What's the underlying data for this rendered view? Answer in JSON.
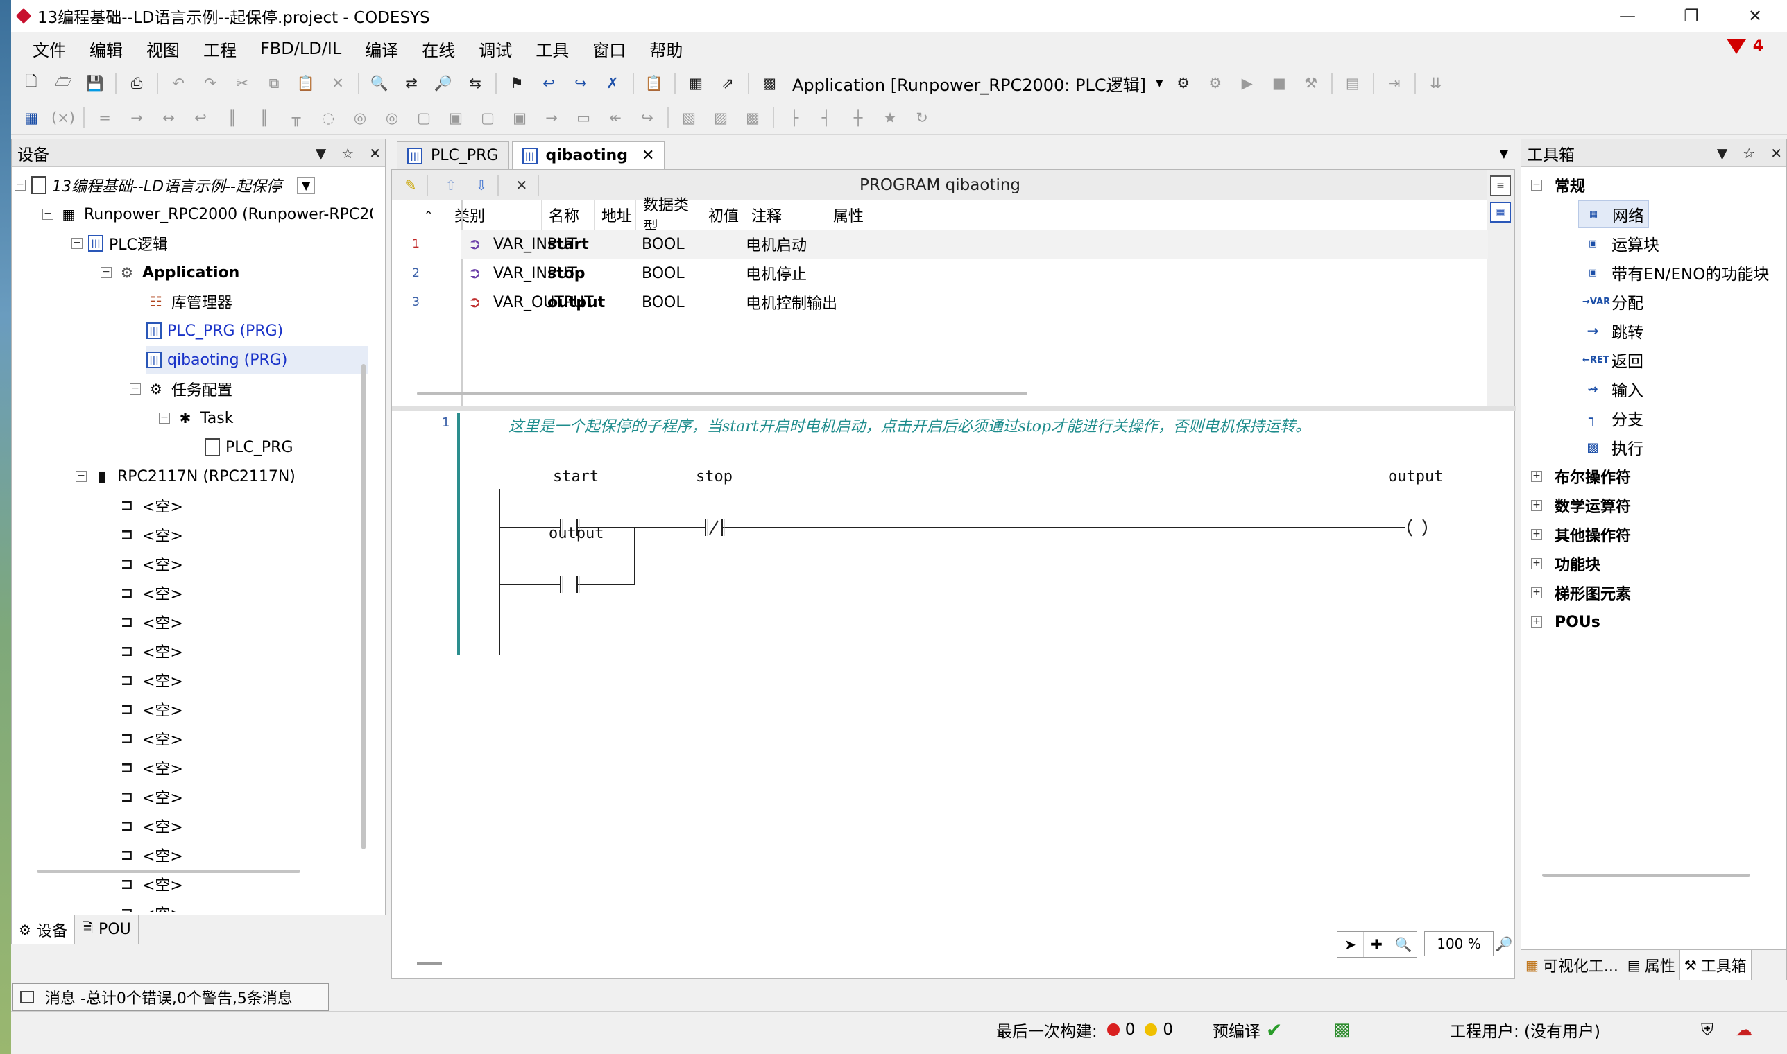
{
  "window": {
    "title": "13编程基础--LD语言示例--起保停.project - CODESYS"
  },
  "menu": [
    "文件",
    "编辑",
    "视图",
    "工程",
    "FBD/LD/IL",
    "编译",
    "在线",
    "调试",
    "工具",
    "窗口",
    "帮助"
  ],
  "message_filter_count": "4",
  "toolbar": {
    "application_selector": "Application [Runpower_RPC2000: PLC逻辑]"
  },
  "device_panel": {
    "title": "设备",
    "tree": [
      {
        "label": "13编程基础--LD语言示例--起保停"
      },
      {
        "label": "Runpower_RPC2000 (Runpower-RPC2000)"
      },
      {
        "label": "PLC逻辑"
      },
      {
        "label": "Application"
      },
      {
        "label": "库管理器"
      },
      {
        "label": "PLC_PRG (PRG)"
      },
      {
        "label": "qibaoting (PRG)"
      },
      {
        "label": "任务配置"
      },
      {
        "label": "Task"
      },
      {
        "label": "PLC_PRG"
      },
      {
        "label": "RPC2117N (RPC2117N)"
      }
    ],
    "empty_slot_label": "<空>",
    "tabs": [
      {
        "label": "设备"
      },
      {
        "label": "POU"
      }
    ]
  },
  "messages_bar": {
    "text": "消息 -总计0个错误,0个警告,5条消息"
  },
  "editor": {
    "tabs": [
      {
        "label": "PLC_PRG"
      },
      {
        "label": "qibaoting"
      }
    ],
    "program_title": "PROGRAM qibaoting",
    "columns": [
      "类别",
      "名称",
      "地址",
      "数据类型",
      "初值",
      "注释",
      "属性"
    ],
    "variables": [
      {
        "line": "1",
        "scope": "VAR_INPUT",
        "name": "start",
        "address": "",
        "type": "BOOL",
        "init": "",
        "comment": "电机启动",
        "attributes": ""
      },
      {
        "line": "2",
        "scope": "VAR_INPUT",
        "name": "stop",
        "address": "",
        "type": "BOOL",
        "init": "",
        "comment": "电机停止",
        "attributes": ""
      },
      {
        "line": "3",
        "scope": "VAR_OUTPUT",
        "name": "output",
        "address": "",
        "type": "BOOL",
        "init": "",
        "comment": "电机控制输出",
        "attributes": ""
      }
    ],
    "ld": {
      "network_number": "1",
      "comment": "这里是一个起保停的子程序，当start开启时电机启动，点击开启后必须通过stop才能进行关操作，否则电机保持运转。",
      "contacts": [
        {
          "label": "start",
          "kind": "normally_open"
        },
        {
          "label": "stop",
          "kind": "normally_closed"
        },
        {
          "label": "output",
          "kind": "normally_open",
          "branch": "parallel"
        }
      ],
      "coil": {
        "label": "output"
      }
    },
    "zoom": "100 %"
  },
  "toolbox": {
    "title": "工具箱",
    "categories": [
      {
        "label": "常规",
        "expanded": true,
        "items": [
          {
            "label": "网络",
            "icon": "network-icon"
          },
          {
            "label": "运算块",
            "icon": "box-icon"
          },
          {
            "label": "带有EN/ENO的功能块",
            "icon": "box-en-icon"
          },
          {
            "label": "分配",
            "icon": "assign-icon"
          },
          {
            "label": "跳转",
            "icon": "jump-icon"
          },
          {
            "label": "返回",
            "icon": "return-icon"
          },
          {
            "label": "输入",
            "icon": "input-icon"
          },
          {
            "label": "分支",
            "icon": "branch-icon"
          },
          {
            "label": "执行",
            "icon": "execute-icon"
          }
        ]
      },
      {
        "label": "布尔操作符",
        "expanded": false
      },
      {
        "label": "数学运算符",
        "expanded": false
      },
      {
        "label": "其他操作符",
        "expanded": false
      },
      {
        "label": "功能块",
        "expanded": false
      },
      {
        "label": "梯形图元素",
        "expanded": false
      },
      {
        "label": "POUs",
        "expanded": false
      }
    ],
    "tabs": [
      {
        "label": "可视化工..."
      },
      {
        "label": "属性"
      },
      {
        "label": "工具箱"
      }
    ]
  },
  "status": {
    "last_build_label": "最后一次构建:",
    "errors": "0",
    "warnings": "0",
    "precompile_label": "预编译",
    "project_user": "工程用户: (没有用户)"
  },
  "colors": {
    "comment": "#1e8c8c",
    "link": "#1a33c8",
    "network_bar": "#2c8e8e",
    "error_red": "#d10000"
  }
}
